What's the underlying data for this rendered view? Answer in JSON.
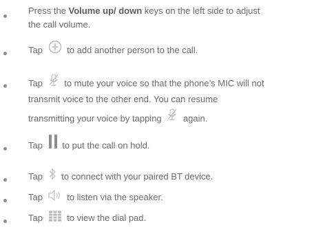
{
  "instructions": [
    {
      "pre": "Press the ",
      "bold": "Volume up/ down",
      "post_line1": " keys on the left side to adjust",
      "line2": "the call volume."
    },
    {
      "pre": "Tap",
      "icon": "add-person-icon",
      "post": "to add another person to the call."
    },
    {
      "pre": "Tap",
      "icon": "mute-mic-icon",
      "post_line1": "to mute your voice so that the phone’s MIC will not",
      "line2": "transmit voice to the other end. You can resume",
      "line3_pre": "transmitting your voice by tapping",
      "line3_icon": "mute-mic-icon",
      "line3_post": "again."
    },
    {
      "pre": "Tap",
      "icon": "hold-icon",
      "post": "to put the call on hold."
    },
    {
      "pre": "Tap",
      "icon": "bluetooth-icon",
      "post": "to connect with your paired BT device."
    },
    {
      "pre": "Tap",
      "icon": "speaker-icon",
      "post": "to listen via the speaker."
    },
    {
      "pre": "Tap",
      "icon": "dial-pad-icon",
      "post": "to view the dial pad."
    }
  ],
  "colors": {
    "text": "#6b6b6b",
    "bold": "#5c5c5c",
    "icon": "#b9b9b9",
    "hold": "#8f8f8f"
  }
}
